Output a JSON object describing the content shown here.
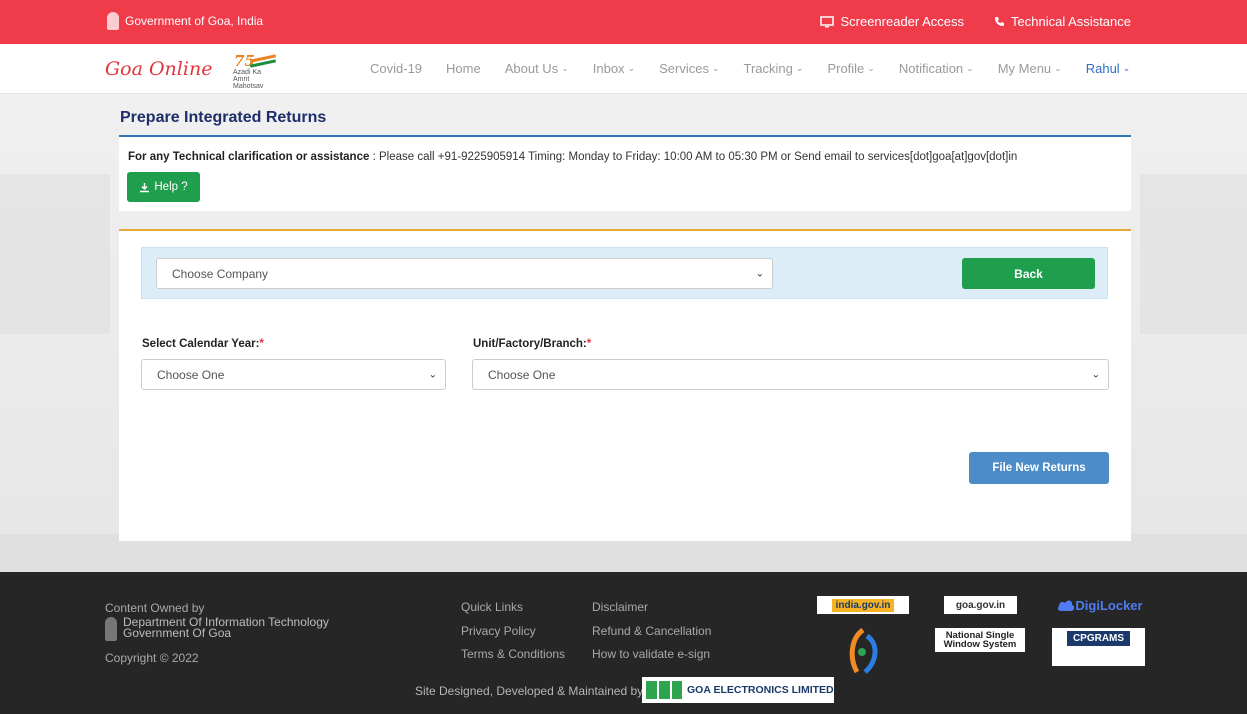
{
  "topbar": {
    "gov_label": "Government of Goa, India",
    "screenreader": "Screenreader Access",
    "tech": "Technical Assistance"
  },
  "nav": {
    "brand": "Goa Online",
    "azadi_line": "Azadi Ka Amrit Mahotsav",
    "items": [
      {
        "label": "Covid-19",
        "dropdown": false
      },
      {
        "label": "Home",
        "dropdown": false
      },
      {
        "label": "About Us",
        "dropdown": true
      },
      {
        "label": "Inbox",
        "dropdown": true
      },
      {
        "label": "Services",
        "dropdown": true
      },
      {
        "label": "Tracking",
        "dropdown": true
      },
      {
        "label": "Profile",
        "dropdown": true
      },
      {
        "label": "Notification",
        "dropdown": true
      },
      {
        "label": "My Menu",
        "dropdown": true
      }
    ],
    "user": "Rahul"
  },
  "page": {
    "title": "Prepare Integrated Returns",
    "info_label": "For any Technical clarification or assistance",
    "info_text": "Please call +91-9225905914 Timing: Monday to Friday: 10:00 AM to 05:30 PM or Send email to services[dot]goa[at]gov[dot]in",
    "help_label": "Help ?"
  },
  "form": {
    "company_select": "Choose Company",
    "back_label": "Back",
    "year_label": "Select Calendar Year:",
    "year_value": "Choose One",
    "unit_label": "Unit/Factory/Branch:",
    "unit_value": "Choose One",
    "file_label": "File New Returns"
  },
  "footer": {
    "owned": "Content Owned by",
    "dept1": "Department Of Information Technology",
    "dept2": "Government Of Goa",
    "copyright": "Copyright © 2022",
    "links": [
      "Quick Links",
      "Privacy Policy",
      "Terms & Conditions",
      "Disclaimer",
      "Refund & Cancellation",
      "How to validate e-sign"
    ],
    "logos": {
      "india": "india.gov.in",
      "goa": "goa.gov.in",
      "digi": "DigiLocker",
      "nsws1": "National Single",
      "nsws2": "Window System",
      "cpgrams": "CPGRAMS"
    },
    "site_dev": "Site Designed, Developed & Maintained by",
    "gel": "GOA ELECTRONICS LIMITED"
  }
}
